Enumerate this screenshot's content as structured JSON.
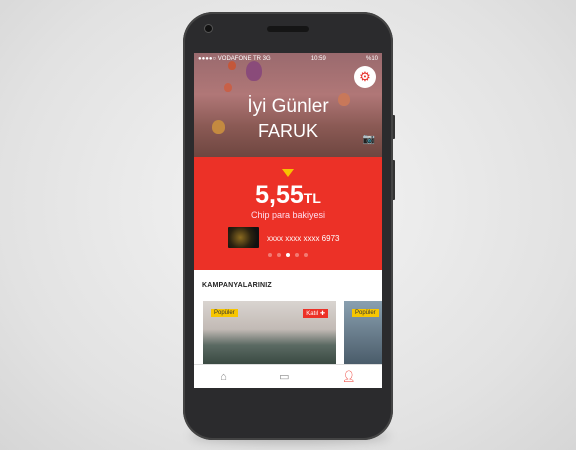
{
  "status_bar": {
    "carrier": "●●●●○ VODAFONE TR  3G",
    "time": "10:59",
    "battery": "%10"
  },
  "hero": {
    "greeting": "İyi Günler",
    "name": "FARUK"
  },
  "balance": {
    "amount": "5,55",
    "currency": "TL",
    "label": "Chip para bakiyesi",
    "card_number": "xxxx xxxx xxxx 6973",
    "pager_total": 5,
    "pager_active": 3
  },
  "campaigns": {
    "title": "KAMPANYALARINIZ",
    "tiles": [
      {
        "badge": "Popüler",
        "action": "Katıl ✚"
      },
      {
        "badge": "Popüler"
      }
    ]
  },
  "nav": [
    {
      "icon": "home-icon",
      "active": false
    },
    {
      "icon": "wallet-icon",
      "active": false
    },
    {
      "icon": "profile-icon",
      "active": true
    }
  ],
  "colors": {
    "accent": "#ec3127",
    "badge": "#f7c600"
  }
}
